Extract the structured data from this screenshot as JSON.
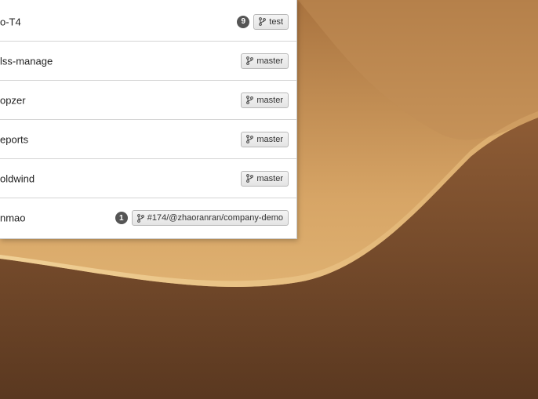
{
  "repos": [
    {
      "name": "o-T4",
      "count": "9",
      "branch": "test"
    },
    {
      "name": "lss-manage",
      "count": "",
      "branch": "master"
    },
    {
      "name": "opzer",
      "count": "",
      "branch": "master"
    },
    {
      "name": "eports",
      "count": "",
      "branch": "master"
    },
    {
      "name": "oldwind",
      "count": "",
      "branch": "master"
    },
    {
      "name": "nmao",
      "count": "1",
      "branch": "#174/@zhaoranran/company-demo"
    }
  ],
  "icons": {
    "branch": "git-branch-icon"
  },
  "colors": {
    "badge": "#555555",
    "tag_border": "#b8b8b8"
  }
}
